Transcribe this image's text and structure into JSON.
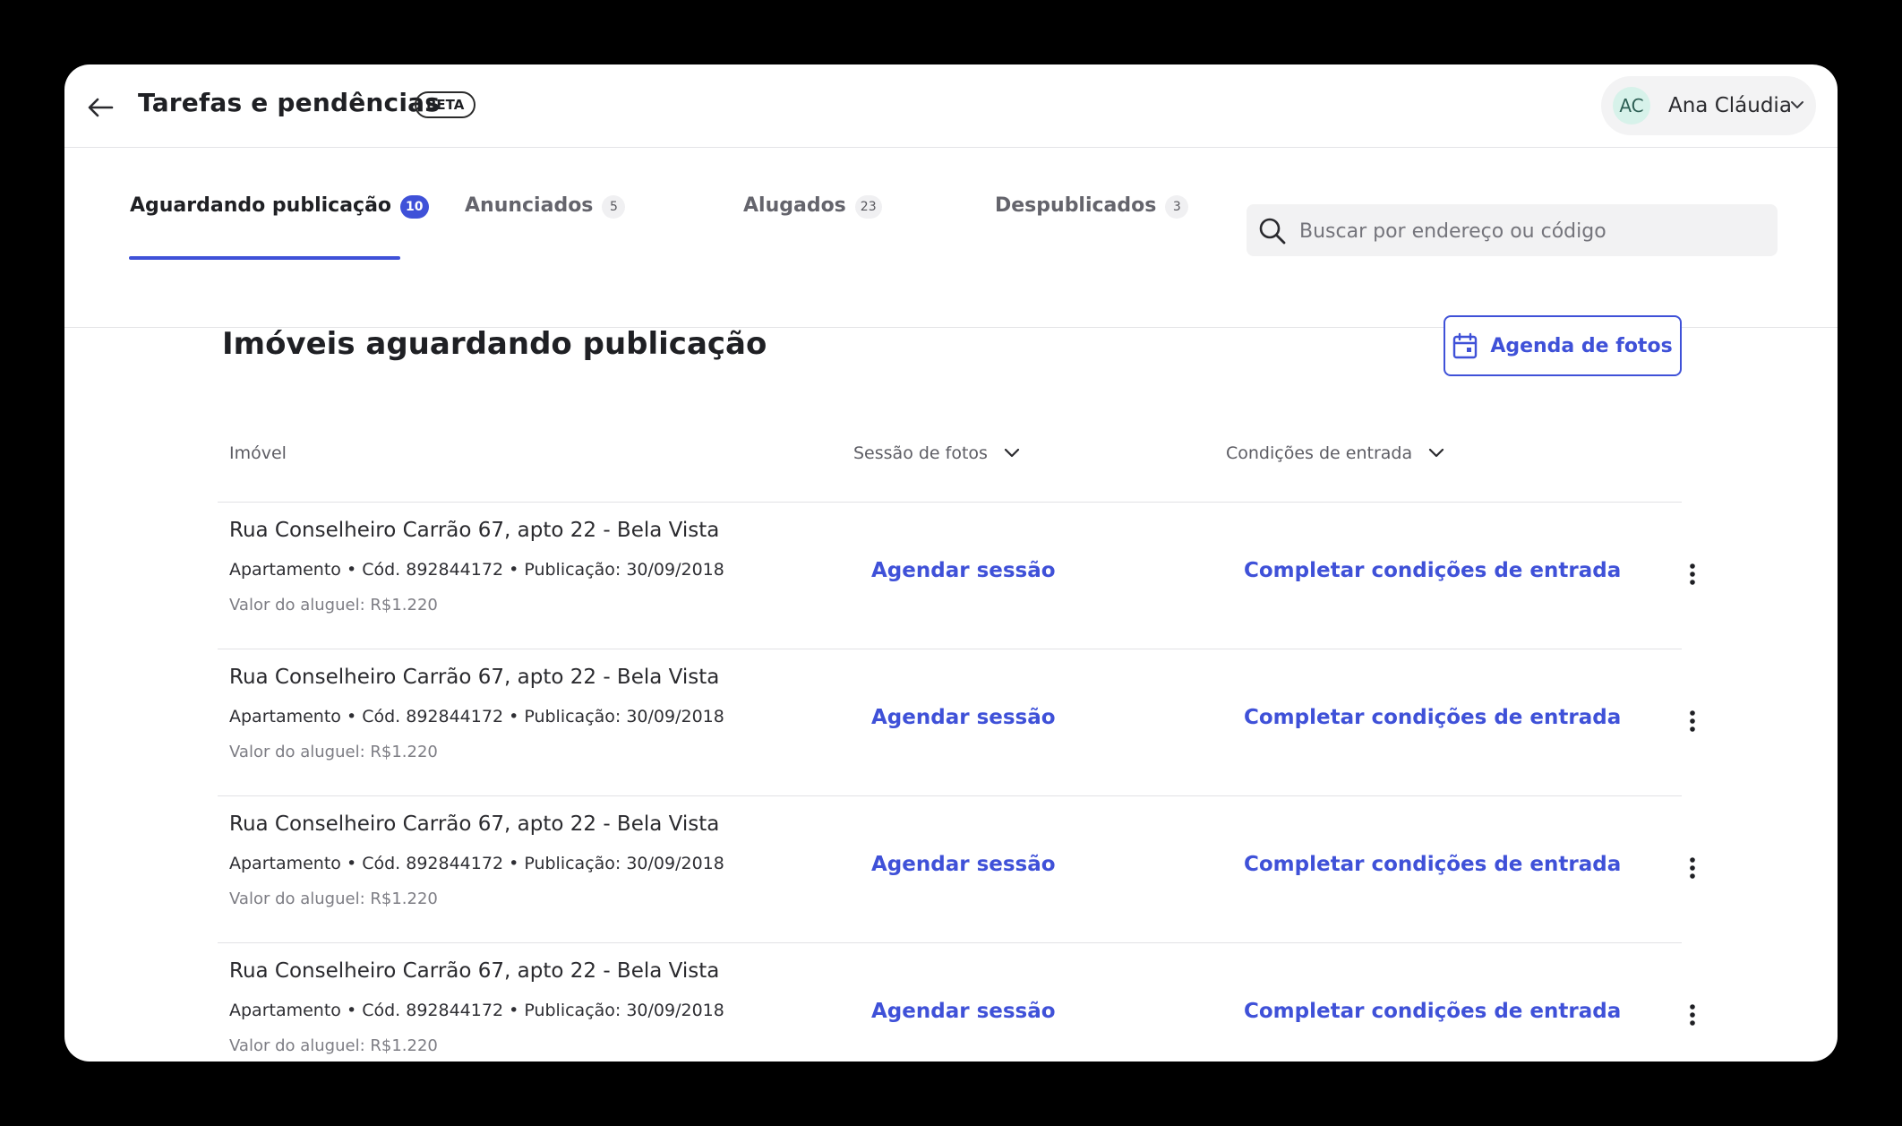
{
  "header": {
    "title": "Tarefas e pendências",
    "badge": "BETA",
    "user": {
      "initials": "AC",
      "name": "Ana Cláudia"
    }
  },
  "tabs": [
    {
      "label": "Aguardando publicação",
      "count": "10",
      "active": true
    },
    {
      "label": "Anunciados",
      "count": "5"
    },
    {
      "label": "Alugados",
      "count": "23"
    },
    {
      "label": "Despublicados",
      "count": "3"
    }
  ],
  "search": {
    "placeholder": "Buscar por endereço ou código",
    "value": ""
  },
  "main": {
    "title": "Imóveis aguardando publicação",
    "photo_agenda_label": "Agenda de fotos",
    "columns": {
      "property": "Imóvel",
      "photo_session": "Sessão de fotos",
      "entry_conditions": "Condições de entrada"
    },
    "rows": [
      {
        "address": "Rua Conselheiro Carrão 67, apto 22 - Bela Vista",
        "meta": "Apartamento • Cód. 892844172 • Publicação: 30/09/2018",
        "rent": "Valor do aluguel: R$1.220",
        "session_action": "Agendar sessão",
        "conditions_action": "Completar condições de entrada"
      },
      {
        "address": "Rua Conselheiro Carrão 67, apto 22 - Bela Vista",
        "meta": "Apartamento • Cód. 892844172 • Publicação: 30/09/2018",
        "rent": "Valor do aluguel: R$1.220",
        "session_action": "Agendar sessão",
        "conditions_action": "Completar condições de entrada"
      },
      {
        "address": "Rua Conselheiro Carrão 67, apto 22 - Bela Vista",
        "meta": "Apartamento • Cód. 892844172 • Publicação: 30/09/2018",
        "rent": "Valor do aluguel: R$1.220",
        "session_action": "Agendar sessão",
        "conditions_action": "Completar condições de entrada"
      },
      {
        "address": "Rua Conselheiro Carrão 67, apto 22 - Bela Vista",
        "meta": "Apartamento • Cód. 892844172 • Publicação: 30/09/2018",
        "rent": "Valor do aluguel: R$1.220",
        "session_action": "Agendar sessão",
        "conditions_action": "Completar condições de entrada"
      }
    ]
  },
  "colors": {
    "accent": "#3f51d8",
    "avatar_bg": "#d7f2ea",
    "text": "#1f2024"
  },
  "icons": [
    "back-arrow-icon",
    "chevron-down-icon",
    "search-icon",
    "calendar-icon",
    "more-vertical-icon"
  ]
}
